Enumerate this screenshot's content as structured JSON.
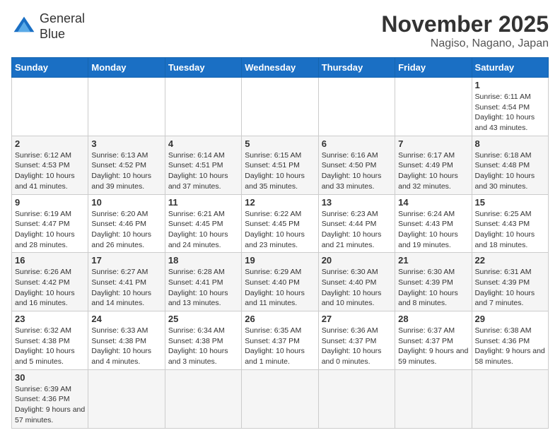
{
  "header": {
    "logo_general": "General",
    "logo_blue": "Blue",
    "month_title": "November 2025",
    "location": "Nagiso, Nagano, Japan"
  },
  "days_of_week": [
    "Sunday",
    "Monday",
    "Tuesday",
    "Wednesday",
    "Thursday",
    "Friday",
    "Saturday"
  ],
  "weeks": [
    [
      {
        "day": "",
        "info": ""
      },
      {
        "day": "",
        "info": ""
      },
      {
        "day": "",
        "info": ""
      },
      {
        "day": "",
        "info": ""
      },
      {
        "day": "",
        "info": ""
      },
      {
        "day": "",
        "info": ""
      },
      {
        "day": "1",
        "info": "Sunrise: 6:11 AM\nSunset: 4:54 PM\nDaylight: 10 hours and 43 minutes."
      }
    ],
    [
      {
        "day": "2",
        "info": "Sunrise: 6:12 AM\nSunset: 4:53 PM\nDaylight: 10 hours and 41 minutes."
      },
      {
        "day": "3",
        "info": "Sunrise: 6:13 AM\nSunset: 4:52 PM\nDaylight: 10 hours and 39 minutes."
      },
      {
        "day": "4",
        "info": "Sunrise: 6:14 AM\nSunset: 4:51 PM\nDaylight: 10 hours and 37 minutes."
      },
      {
        "day": "5",
        "info": "Sunrise: 6:15 AM\nSunset: 4:51 PM\nDaylight: 10 hours and 35 minutes."
      },
      {
        "day": "6",
        "info": "Sunrise: 6:16 AM\nSunset: 4:50 PM\nDaylight: 10 hours and 33 minutes."
      },
      {
        "day": "7",
        "info": "Sunrise: 6:17 AM\nSunset: 4:49 PM\nDaylight: 10 hours and 32 minutes."
      },
      {
        "day": "8",
        "info": "Sunrise: 6:18 AM\nSunset: 4:48 PM\nDaylight: 10 hours and 30 minutes."
      }
    ],
    [
      {
        "day": "9",
        "info": "Sunrise: 6:19 AM\nSunset: 4:47 PM\nDaylight: 10 hours and 28 minutes."
      },
      {
        "day": "10",
        "info": "Sunrise: 6:20 AM\nSunset: 4:46 PM\nDaylight: 10 hours and 26 minutes."
      },
      {
        "day": "11",
        "info": "Sunrise: 6:21 AM\nSunset: 4:45 PM\nDaylight: 10 hours and 24 minutes."
      },
      {
        "day": "12",
        "info": "Sunrise: 6:22 AM\nSunset: 4:45 PM\nDaylight: 10 hours and 23 minutes."
      },
      {
        "day": "13",
        "info": "Sunrise: 6:23 AM\nSunset: 4:44 PM\nDaylight: 10 hours and 21 minutes."
      },
      {
        "day": "14",
        "info": "Sunrise: 6:24 AM\nSunset: 4:43 PM\nDaylight: 10 hours and 19 minutes."
      },
      {
        "day": "15",
        "info": "Sunrise: 6:25 AM\nSunset: 4:43 PM\nDaylight: 10 hours and 18 minutes."
      }
    ],
    [
      {
        "day": "16",
        "info": "Sunrise: 6:26 AM\nSunset: 4:42 PM\nDaylight: 10 hours and 16 minutes."
      },
      {
        "day": "17",
        "info": "Sunrise: 6:27 AM\nSunset: 4:41 PM\nDaylight: 10 hours and 14 minutes."
      },
      {
        "day": "18",
        "info": "Sunrise: 6:28 AM\nSunset: 4:41 PM\nDaylight: 10 hours and 13 minutes."
      },
      {
        "day": "19",
        "info": "Sunrise: 6:29 AM\nSunset: 4:40 PM\nDaylight: 10 hours and 11 minutes."
      },
      {
        "day": "20",
        "info": "Sunrise: 6:30 AM\nSunset: 4:40 PM\nDaylight: 10 hours and 10 minutes."
      },
      {
        "day": "21",
        "info": "Sunrise: 6:30 AM\nSunset: 4:39 PM\nDaylight: 10 hours and 8 minutes."
      },
      {
        "day": "22",
        "info": "Sunrise: 6:31 AM\nSunset: 4:39 PM\nDaylight: 10 hours and 7 minutes."
      }
    ],
    [
      {
        "day": "23",
        "info": "Sunrise: 6:32 AM\nSunset: 4:38 PM\nDaylight: 10 hours and 5 minutes."
      },
      {
        "day": "24",
        "info": "Sunrise: 6:33 AM\nSunset: 4:38 PM\nDaylight: 10 hours and 4 minutes."
      },
      {
        "day": "25",
        "info": "Sunrise: 6:34 AM\nSunset: 4:38 PM\nDaylight: 10 hours and 3 minutes."
      },
      {
        "day": "26",
        "info": "Sunrise: 6:35 AM\nSunset: 4:37 PM\nDaylight: 10 hours and 1 minute."
      },
      {
        "day": "27",
        "info": "Sunrise: 6:36 AM\nSunset: 4:37 PM\nDaylight: 10 hours and 0 minutes."
      },
      {
        "day": "28",
        "info": "Sunrise: 6:37 AM\nSunset: 4:37 PM\nDaylight: 9 hours and 59 minutes."
      },
      {
        "day": "29",
        "info": "Sunrise: 6:38 AM\nSunset: 4:36 PM\nDaylight: 9 hours and 58 minutes."
      }
    ],
    [
      {
        "day": "30",
        "info": "Sunrise: 6:39 AM\nSunset: 4:36 PM\nDaylight: 9 hours and 57 minutes."
      },
      {
        "day": "",
        "info": ""
      },
      {
        "day": "",
        "info": ""
      },
      {
        "day": "",
        "info": ""
      },
      {
        "day": "",
        "info": ""
      },
      {
        "day": "",
        "info": ""
      },
      {
        "day": "",
        "info": ""
      }
    ]
  ]
}
